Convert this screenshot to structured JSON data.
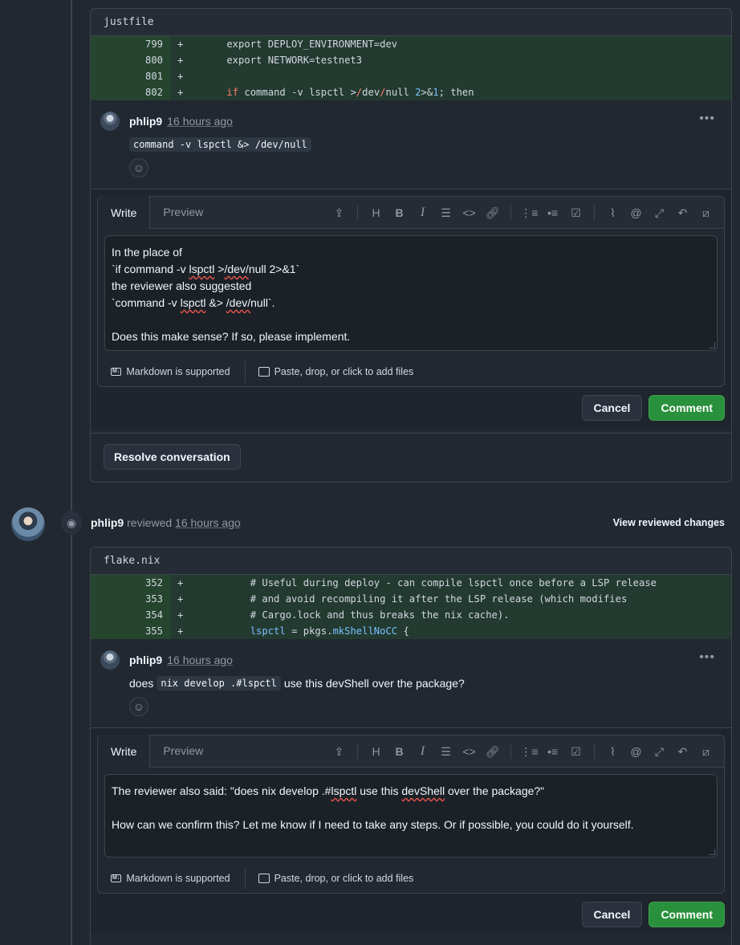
{
  "thread1": {
    "file": "justfile",
    "diff": [
      {
        "ln": "799",
        "sign": "+",
        "code": "    export DEPLOY_ENVIRONMENT=dev"
      },
      {
        "ln": "800",
        "sign": "+",
        "code": "    export NETWORK=testnet3"
      },
      {
        "ln": "801",
        "sign": "+",
        "code": ""
      },
      {
        "ln": "802",
        "sign": "+",
        "code": "    if command -v lspctl >/dev/null 2>&1; then"
      }
    ],
    "comment": {
      "author": "phlip9",
      "time": "16 hours ago",
      "code": "command -v lspctl &> /dev/null"
    },
    "editor": {
      "write_tab": "Write",
      "preview_tab": "Preview",
      "lines": [
        "In the place of",
        "`if command -v lspctl >/dev/null 2>&1`",
        "the reviewer also suggested",
        "`command -v lspctl &> /dev/null`.",
        "",
        "Does this make sense? If so, please implement."
      ],
      "markdown_note": "Markdown is supported",
      "files_note": "Paste, drop, or click to add files"
    },
    "cancel": "Cancel",
    "submit": "Comment",
    "resolve": "Resolve conversation"
  },
  "review": {
    "author": "phlip9",
    "action": "reviewed",
    "time": "16 hours ago",
    "view_changes": "View reviewed changes"
  },
  "thread2": {
    "file": "flake.nix",
    "diff": [
      {
        "ln": "352",
        "sign": "+",
        "code": "        # Useful during deploy - can compile lspctl once before a LSP release"
      },
      {
        "ln": "353",
        "sign": "+",
        "code": "        # and avoid recompiling it after the LSP release (which modifies"
      },
      {
        "ln": "354",
        "sign": "+",
        "code": "        # Cargo.lock and thus breaks the nix cache)."
      },
      {
        "ln": "355",
        "sign": "+",
        "code": "        lspctl = pkgs.mkShellNoCC {"
      }
    ],
    "comment": {
      "author": "phlip9",
      "time": "16 hours ago",
      "pre": "does",
      "code": "nix develop .#lspctl",
      "post": "use this devShell over the package?"
    },
    "editor": {
      "write_tab": "Write",
      "preview_tab": "Preview",
      "lines": [
        "The reviewer also said: \"does nix develop .#lspctl use this devShell over the package?\"",
        "",
        "How can we confirm this? Let me know if I need to take any steps. Or if possible, you could do it yourself."
      ],
      "markdown_note": "Markdown is supported",
      "files_note": "Paste, drop, or click to add files"
    },
    "cancel": "Cancel",
    "submit": "Comment"
  },
  "toolbar_icons": [
    "template-icon",
    "heading-icon",
    "bold-icon",
    "italic-icon",
    "quote-icon",
    "code-icon",
    "link-icon",
    "ordered-list-icon",
    "unordered-list-icon",
    "task-list-icon",
    "attach-icon",
    "mention-icon",
    "reference-icon",
    "reply-icon",
    "slash-icon"
  ],
  "colors": {
    "addition_bg": "#233a30",
    "primary_button": "#29903b",
    "background": "#212830"
  }
}
